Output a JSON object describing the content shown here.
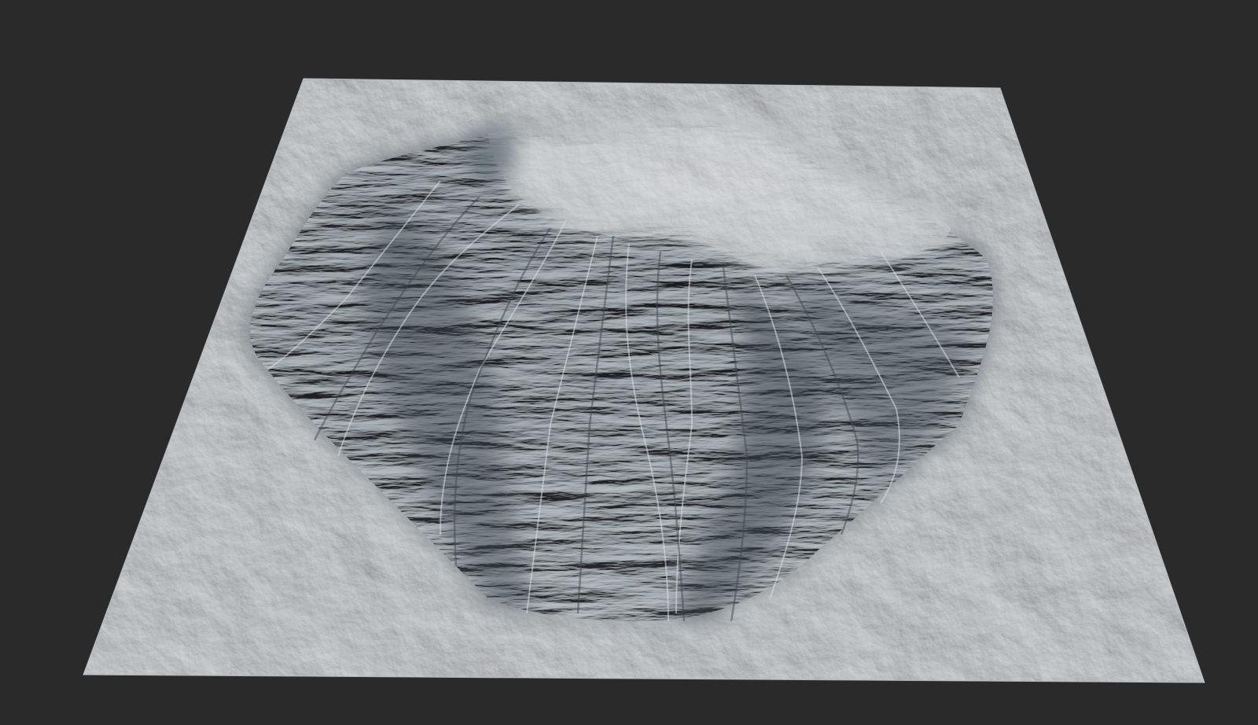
{
  "scene": {
    "subject": "terrain-heightmap-render",
    "background_color": "#2a2a2a",
    "colors": {
      "plain_light": "#e3e7ea",
      "plain_mid": "#cdd3d7",
      "plain_shadow": "#a9b1b7",
      "slope_dark": "#4a5560",
      "slope_mid": "#7a858e",
      "ridge_highlight": "#f2f4f5",
      "summit_snow": "#e8ecee"
    }
  }
}
